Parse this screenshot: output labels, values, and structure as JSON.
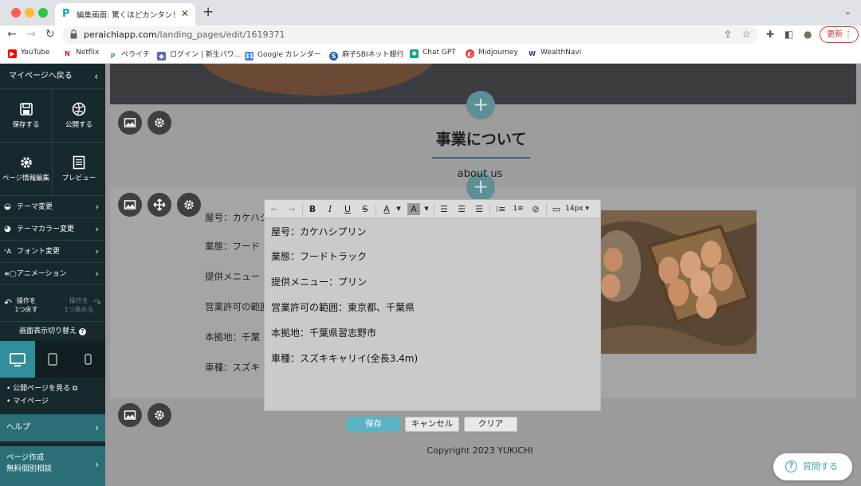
{
  "browser": {
    "tab_title": "編集画面: 驚くほどカンタン！無料",
    "tab_favicon": "P",
    "url_domain": "peraichiapp.com",
    "url_path": "/landing_pages/edit/1619371",
    "update_label": "更新",
    "bookmarks": [
      {
        "label": "YouTube",
        "icon": "youtube-icon",
        "color": "#ff0000"
      },
      {
        "label": "Netflix",
        "icon": "netflix-icon",
        "color": "#e50914"
      },
      {
        "label": "ペライチ",
        "icon": "peraichi-icon",
        "color": "#1b9ad1"
      },
      {
        "label": "ログイン | 新生パワ...",
        "icon": "login-site-icon",
        "color": "#5c6bc0"
      },
      {
        "label": "Google カレンダー",
        "icon": "calendar-icon",
        "color": "#4285f4"
      },
      {
        "label": "麻子SBIネット銀行",
        "icon": "bank-icon",
        "color": "#1565c0"
      },
      {
        "label": "Chat GPT",
        "icon": "chatgpt-icon",
        "color": "#10a37f"
      },
      {
        "label": "Midjourney",
        "icon": "midjourney-icon",
        "color": "#e53935"
      },
      {
        "label": "WealthNavi",
        "icon": "wealthnavi-icon",
        "color": "#1a3c8f"
      }
    ]
  },
  "sidebar": {
    "back_label": "マイページへ戻る",
    "save_label": "保存する",
    "publish_label": "公開する",
    "page_info_label": "ページ情報編集",
    "preview_label": "プレビュー",
    "menu": [
      {
        "label": "テーマ変更",
        "icon": "theme-icon"
      },
      {
        "label": "テーマカラー変更",
        "icon": "palette-icon"
      },
      {
        "label": "フォント変更",
        "icon": "font-icon"
      },
      {
        "label": "アニメーション",
        "icon": "animation-icon"
      }
    ],
    "undo_line1": "操作を",
    "undo_line2": "1つ戻す",
    "redo_line1": "操作を",
    "redo_line2": "1つ進める",
    "display_switch_label": "画面表示切り替え",
    "links": [
      "公開ページを見る",
      "マイページ"
    ],
    "help_label": "ヘルプ",
    "consult_line1": "ページ作成",
    "consult_line2": "無料個別相談"
  },
  "page": {
    "heading": "事業について",
    "subheading": "about us",
    "background_lines": [
      "屋号：カケハシ",
      "業態：フード",
      "提供メニュー",
      "営業許可の範囲",
      "本拠地：千葉",
      "車種：スズキ"
    ],
    "copyright": "Copyright 2023 YUKICHI"
  },
  "editor": {
    "font_size": "14px",
    "lines": [
      "屋号：カケハシプリン",
      "業態：フードトラック",
      "提供メニュー：プリン",
      "営業許可の範囲：東京都、千葉県",
      "本拠地：千葉県習志野市",
      "車種：スズキキャリイ(全長3.4m)"
    ],
    "save_label": "保存",
    "cancel_label": "キャンセル",
    "clear_label": "クリア"
  },
  "help_widget": {
    "label": "質問する"
  },
  "colors": {
    "sidebar_bg": "#162a2e",
    "accent": "#5ab3c5",
    "heading_underline": "#2e6a73",
    "update_red": "#d93025"
  }
}
